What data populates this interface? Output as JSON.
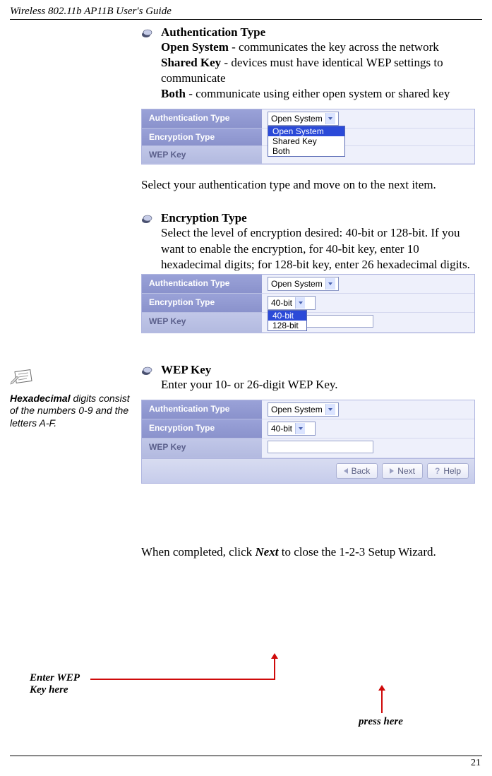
{
  "header": {
    "title": "Wireless 802.11b AP11B User's Guide"
  },
  "section1": {
    "heading": "Authentication Type",
    "open_label": "Open System",
    "open_desc": " - communicates the key across the network",
    "shared_label": "Shared Key",
    "shared_desc": " - devices must have identical WEP settings to communicate",
    "both_label": "Both",
    "both_desc": " - communicate using either open system or shared key",
    "after": "Select your authentication type and move on to the next item."
  },
  "shot1": {
    "row_auth": "Authentication Type",
    "row_enc": "Encryption Type",
    "row_wep": "WEP Key",
    "selected": "Open System",
    "options": {
      "a": "Open System",
      "b": "Shared Key",
      "c": "Both"
    }
  },
  "section2": {
    "heading": "Encryption Type",
    "body": "Select the level of encryption desired: 40-bit or 128-bit. If you want to enable the encryption, for 40-bit key, enter 10 hexadecimal digits; for 128-bit key, enter 26 hexadecimal digits."
  },
  "shot2": {
    "row_auth": "Authentication Type",
    "row_enc": "Encryption Type",
    "row_wep": "WEP Key",
    "auth_value": "Open System",
    "selected": "40-bit",
    "options": {
      "a": "40-bit",
      "b": "128-bit"
    }
  },
  "sidenote": {
    "bold": "Hexadecimal",
    "rest": " digits consist of the numbers 0-9 and the letters A-F."
  },
  "section3": {
    "heading": "WEP Key",
    "body": "Enter your 10- or 26-digit WEP Key."
  },
  "shot3": {
    "row_auth": "Authentication Type",
    "row_enc": "Encryption Type",
    "row_wep": "WEP Key",
    "auth_value": "Open System",
    "enc_value": "40-bit",
    "btn_back": "Back",
    "btn_next": "Next",
    "btn_help": "Help"
  },
  "callouts": {
    "enter_wep_1": "Enter WEP",
    "enter_wep_2": "Key here",
    "press_here": "press here"
  },
  "closing": {
    "pre": "When completed, click ",
    "next": "Next",
    "post": " to close the 1-2-3 Setup Wizard."
  },
  "footer": {
    "page": "21"
  }
}
